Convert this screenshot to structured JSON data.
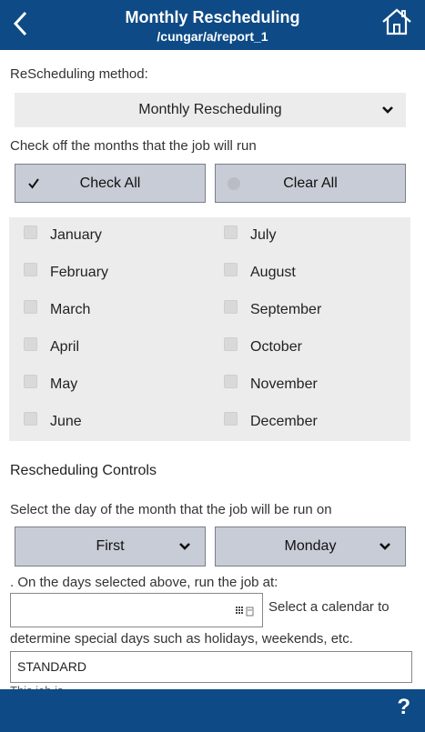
{
  "header": {
    "title": "Monthly Rescheduling",
    "subtitle": "/cungar/a/report_1",
    "colors": {
      "bar": "#0e4a86",
      "text": "#ffffff"
    }
  },
  "method": {
    "label": "ReScheduling method:",
    "selected": "Monthly Rescheduling"
  },
  "months_section": {
    "instruction": "Check off the months that the job will run",
    "check_all_label": "Check All",
    "clear_all_label": "Clear All",
    "months": [
      {
        "label": "January",
        "checked": false
      },
      {
        "label": "February",
        "checked": false
      },
      {
        "label": "March",
        "checked": false
      },
      {
        "label": "April",
        "checked": false
      },
      {
        "label": "May",
        "checked": false
      },
      {
        "label": "June",
        "checked": false
      },
      {
        "label": "July",
        "checked": false
      },
      {
        "label": "August",
        "checked": false
      },
      {
        "label": "September",
        "checked": false
      },
      {
        "label": "October",
        "checked": false
      },
      {
        "label": "November",
        "checked": false
      },
      {
        "label": "December",
        "checked": false
      }
    ]
  },
  "controls": {
    "title": "Rescheduling Controls",
    "day_instruction": "Select the day of the month that the job will be run on",
    "occurrence_selected": "First",
    "weekday_selected": "Monday",
    "time_label": ". On the days selected above, run the job at:",
    "time_value": "",
    "calendar_hint_1": "Select a calendar to",
    "calendar_hint_2": "determine special days such as holidays, weekends, etc.",
    "calendar_value": "STANDARD",
    "cutoff_text": "This job is"
  },
  "footer": {
    "help_label": "?"
  },
  "icons": {
    "back": "chevron-left-icon",
    "home": "home-icon",
    "help": "help-icon",
    "dropdown": "chevron-down-icon",
    "check": "checkmark-icon",
    "clear": "radio-dot-icon",
    "time_picker": "time-picker-icon"
  }
}
